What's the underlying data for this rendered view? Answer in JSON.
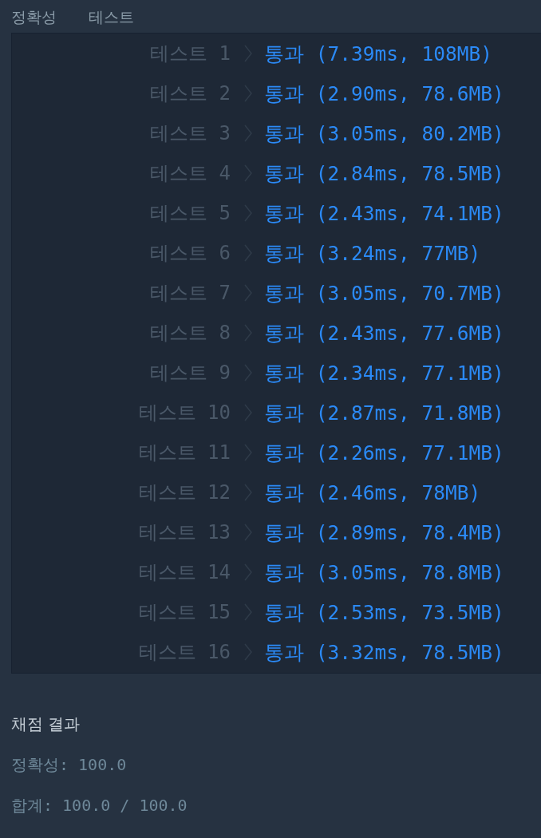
{
  "section_title": "정확성  테스트",
  "tests": [
    {
      "label": "테스트 1",
      "result": "통과 (7.39ms, 108MB)"
    },
    {
      "label": "테스트 2",
      "result": "통과 (2.90ms, 78.6MB)"
    },
    {
      "label": "테스트 3",
      "result": "통과 (3.05ms, 80.2MB)"
    },
    {
      "label": "테스트 4",
      "result": "통과 (2.84ms, 78.5MB)"
    },
    {
      "label": "테스트 5",
      "result": "통과 (2.43ms, 74.1MB)"
    },
    {
      "label": "테스트 6",
      "result": "통과 (3.24ms, 77MB)"
    },
    {
      "label": "테스트 7",
      "result": "통과 (3.05ms, 70.7MB)"
    },
    {
      "label": "테스트 8",
      "result": "통과 (2.43ms, 77.6MB)"
    },
    {
      "label": "테스트 9",
      "result": "통과 (2.34ms, 77.1MB)"
    },
    {
      "label": "테스트 10",
      "result": "통과 (2.87ms, 71.8MB)"
    },
    {
      "label": "테스트 11",
      "result": "통과 (2.26ms, 77.1MB)"
    },
    {
      "label": "테스트 12",
      "result": "통과 (2.46ms, 78MB)"
    },
    {
      "label": "테스트 13",
      "result": "통과 (2.89ms, 78.4MB)"
    },
    {
      "label": "테스트 14",
      "result": "통과 (3.05ms, 78.8MB)"
    },
    {
      "label": "테스트 15",
      "result": "통과 (2.53ms, 73.5MB)"
    },
    {
      "label": "테스트 16",
      "result": "통과 (3.32ms, 78.5MB)"
    }
  ],
  "summary": {
    "title": "채점 결과",
    "lines": [
      "정확성: 100.0",
      "합계: 100.0 / 100.0"
    ]
  }
}
